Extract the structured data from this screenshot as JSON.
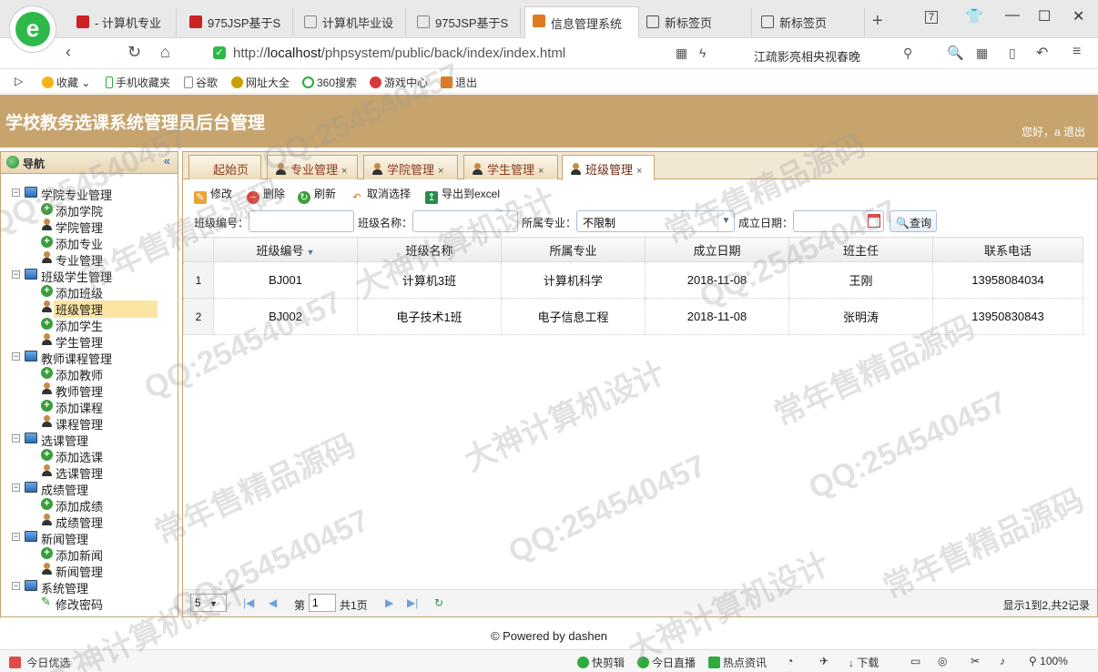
{
  "browser": {
    "tabs": [
      {
        "label": "- 计算机专业",
        "color": "#cc2222"
      },
      {
        "label": "975JSP基于S",
        "color": "#cc2222"
      },
      {
        "label": "计算机毕业设",
        "color": "#888888"
      },
      {
        "label": "975JSP基于S",
        "color": "#888888"
      },
      {
        "label": "信息管理系统",
        "color": "#e07a20"
      },
      {
        "label": "新标签页",
        "color": "#555555"
      },
      {
        "label": "新标签页",
        "color": "#555555"
      }
    ],
    "tab_count": "7",
    "url_prefix": "http://",
    "url_host": "localhost",
    "url_path": "/phpsystem/public/back/index/index.html",
    "search_hint": "江疏影亮相央视春晚",
    "bookmarks": [
      "收藏",
      "手机收藏夹",
      "谷歌",
      "网址大全",
      "360搜索",
      "游戏中心",
      "退出"
    ],
    "zoom": "100%"
  },
  "app": {
    "title": "学校教务选课系统管理员后台管理",
    "greeting": "您好，a",
    "logout": "退出"
  },
  "sidebar": {
    "header": "导航",
    "collapse": "«",
    "groups": [
      {
        "label": "学院专业管理",
        "items": [
          {
            "label": "添加学院",
            "icon": "add-icon"
          },
          {
            "label": "学院管理",
            "icon": "user-icon"
          },
          {
            "label": "添加专业",
            "icon": "add-icon"
          },
          {
            "label": "专业管理",
            "icon": "user-icon"
          }
        ]
      },
      {
        "label": "班级学生管理",
        "items": [
          {
            "label": "添加班级",
            "icon": "add-icon"
          },
          {
            "label": "班级管理",
            "icon": "user-icon",
            "selected": true
          },
          {
            "label": "添加学生",
            "icon": "add-icon"
          },
          {
            "label": "学生管理",
            "icon": "user-icon"
          }
        ]
      },
      {
        "label": "教师课程管理",
        "items": [
          {
            "label": "添加教师",
            "icon": "add-icon"
          },
          {
            "label": "教师管理",
            "icon": "user-icon"
          },
          {
            "label": "添加课程",
            "icon": "add-icon"
          },
          {
            "label": "课程管理",
            "icon": "user-icon"
          }
        ]
      },
      {
        "label": "选课管理",
        "items": [
          {
            "label": "添加选课",
            "icon": "add-icon"
          },
          {
            "label": "选课管理",
            "icon": "user-icon"
          }
        ]
      },
      {
        "label": "成绩管理",
        "items": [
          {
            "label": "添加成绩",
            "icon": "add-icon"
          },
          {
            "label": "成绩管理",
            "icon": "user-icon"
          }
        ]
      },
      {
        "label": "新闻管理",
        "items": [
          {
            "label": "添加新闻",
            "icon": "add-icon"
          },
          {
            "label": "新闻管理",
            "icon": "user-icon"
          }
        ]
      },
      {
        "label": "系统管理",
        "items": [
          {
            "label": "修改密码",
            "icon": "pencil-icon"
          }
        ]
      }
    ]
  },
  "main_tabs": [
    {
      "label": "起始页",
      "closable": false
    },
    {
      "label": "专业管理",
      "closable": true
    },
    {
      "label": "学院管理",
      "closable": true
    },
    {
      "label": "学生管理",
      "closable": true
    },
    {
      "label": "班级管理",
      "closable": true,
      "active": true
    }
  ],
  "toolbar": {
    "edit": "修改",
    "delete": "删除",
    "refresh": "刷新",
    "cancel_select": "取消选择",
    "export": "导出到excel"
  },
  "filters": {
    "class_no_label": "班级编号：",
    "class_no_value": "",
    "class_name_label": "班级名称：",
    "class_name_value": "",
    "major_label": "所属专业：",
    "major_value": "不限制",
    "date_label": "成立日期：",
    "date_value": "",
    "query": "查询"
  },
  "grid": {
    "columns": [
      "班级编号",
      "班级名称",
      "所属专业",
      "成立日期",
      "班主任",
      "联系电话"
    ],
    "rows": [
      {
        "rn": "1",
        "cells": [
          "BJ001",
          "计算机3班",
          "计算机科学",
          "2018-11-08",
          "王刚",
          "13958084034"
        ]
      },
      {
        "rn": "2",
        "cells": [
          "BJ002",
          "电子技术1班",
          "电子信息工程",
          "2018-11-08",
          "张明涛",
          "13950830843"
        ]
      }
    ]
  },
  "pager": {
    "page_size": "5",
    "page_prefix": "第",
    "page_value": "1",
    "page_total": "共1页",
    "summary": "显示1到2,共2记录"
  },
  "footer": "© Powered by dashen",
  "statusbar": [
    "今日优选",
    "快剪辑",
    "今日直播",
    "热点资讯",
    "下载",
    "100%"
  ],
  "watermarks": [
    "QQ:254540457",
    "常年售精品源码",
    "大神计算机设计"
  ]
}
